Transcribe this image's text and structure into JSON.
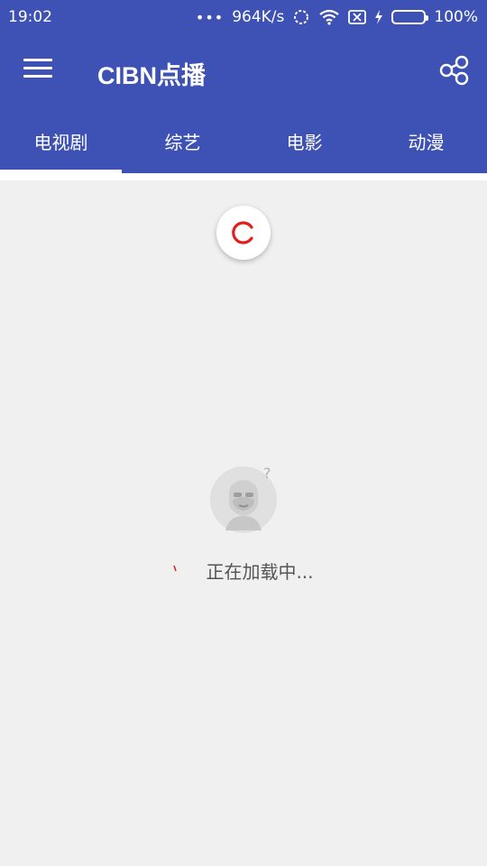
{
  "status_bar": {
    "time": "19:02",
    "more": "•••",
    "network_speed": "964K/s",
    "battery_percent": "100%",
    "icons": [
      "sync-icon",
      "wifi-icon",
      "sim-x-icon",
      "charging-icon",
      "battery-icon"
    ]
  },
  "app_bar": {
    "title": "CIBN点播",
    "menu_icon": "hamburger-menu-icon",
    "share_icon": "share-icon"
  },
  "tabs": [
    {
      "label": "电视剧",
      "active": true
    },
    {
      "label": "综艺",
      "active": false
    },
    {
      "label": "电影",
      "active": false
    },
    {
      "label": "动漫",
      "active": false
    }
  ],
  "content": {
    "loading_text": "正在加载中..."
  },
  "colors": {
    "primary": "#3e51b5",
    "accent_red": "#e01e1e",
    "background": "#f0f0f0",
    "battery_green": "#8bc34a"
  }
}
